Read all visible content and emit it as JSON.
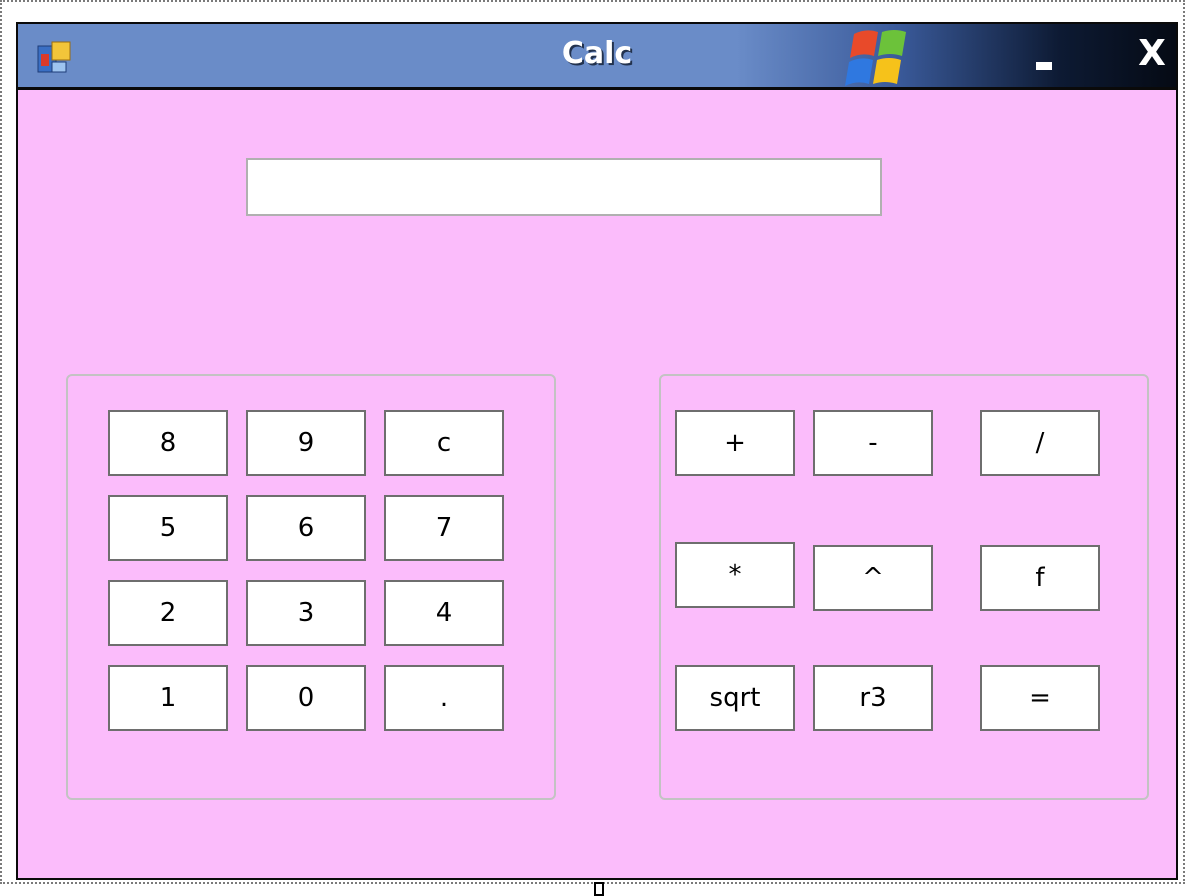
{
  "window": {
    "title": "Calc",
    "minimize_glyph": "_",
    "close_glyph": "X",
    "icons": {
      "app": "app-form-icon",
      "brand": "windows-logo-icon"
    },
    "colors": {
      "form_background": "#fbbcfb",
      "titlebar_light": "#6a8cc8",
      "titlebar_dark": "#050a14"
    }
  },
  "display": {
    "value": "",
    "placeholder": ""
  },
  "keypad": {
    "rows": [
      [
        "8",
        "9",
        "c"
      ],
      [
        "5",
        "6",
        "7"
      ],
      [
        "2",
        "3",
        "4"
      ],
      [
        "1",
        "0",
        "."
      ]
    ]
  },
  "operators": {
    "rows": [
      [
        "+",
        "-",
        "/"
      ],
      [
        "*",
        "^",
        "f"
      ],
      [
        "sqrt",
        "r3",
        "="
      ]
    ]
  }
}
